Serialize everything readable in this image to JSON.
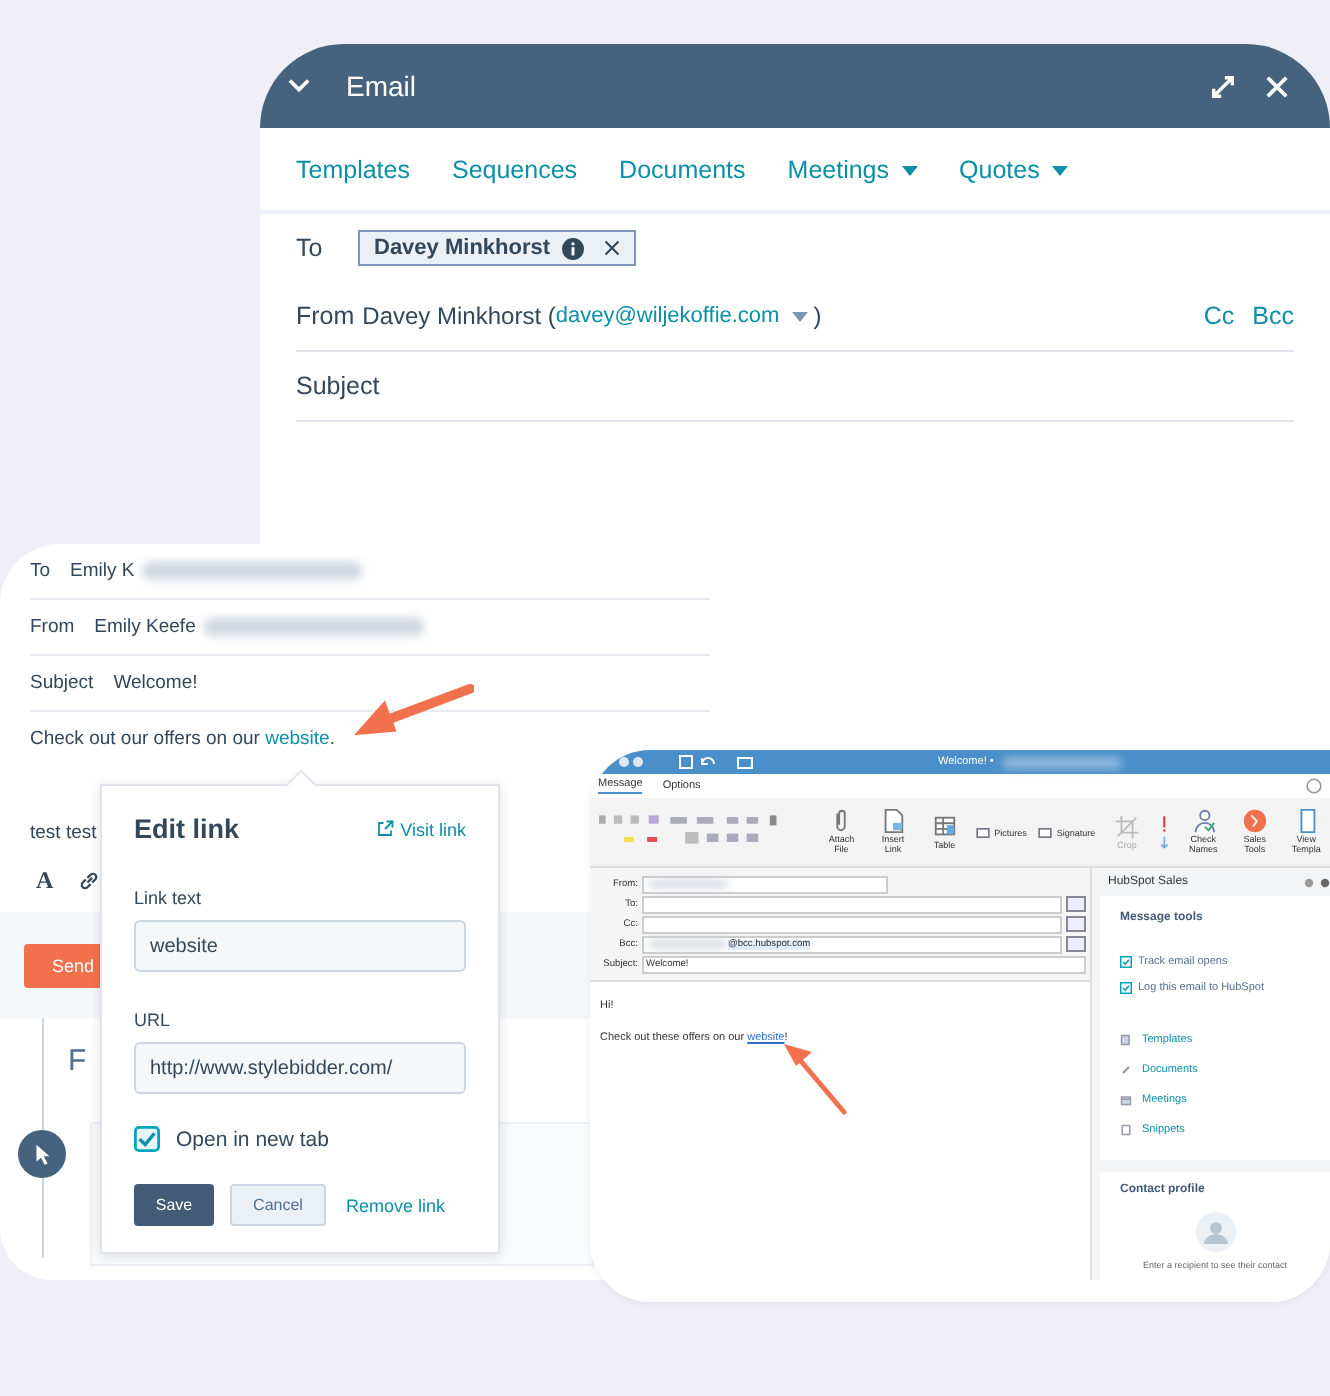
{
  "email_window": {
    "title": "Email",
    "tabs": [
      {
        "label": "Templates",
        "dropdown": false
      },
      {
        "label": "Sequences",
        "dropdown": false
      },
      {
        "label": "Documents",
        "dropdown": false
      },
      {
        "label": "Meetings",
        "dropdown": true
      },
      {
        "label": "Quotes",
        "dropdown": true
      }
    ],
    "to": {
      "label": "To",
      "recipient": "Davey Minkhorst"
    },
    "from": {
      "label": "From",
      "name": "Davey Minkhorst",
      "open": "(",
      "email": "davey@wiljekoffie.com",
      "close": ")"
    },
    "cc": "Cc",
    "bcc": "Bcc",
    "subject_label": "Subject"
  },
  "compose": {
    "rows": [
      {
        "label": "To",
        "value": "Emily K",
        "blurred": true
      },
      {
        "label": "From",
        "value": "Emily Keefe",
        "blurred": true
      },
      {
        "label": "Subject",
        "value": "Welcome!",
        "blurred": false
      }
    ],
    "body": {
      "before": "Check out our offers on our ",
      "link": "website",
      "after": "."
    },
    "second_line": "test test",
    "format_button": "A",
    "send": "Send",
    "heading_fragment": "F"
  },
  "edit_link": {
    "title": "Edit link",
    "visit": "Visit link",
    "link_text_label": "Link text",
    "link_text": "website",
    "url_label": "URL",
    "url": "http://www.stylebidder.com/",
    "open_in_new_tab": {
      "label": "Open in new tab",
      "checked": true
    },
    "save": "Save",
    "cancel": "Cancel",
    "remove": "Remove link"
  },
  "outlook": {
    "title": "Welcome! •",
    "tabs": [
      {
        "label": "Message",
        "selected": true
      },
      {
        "label": "Options",
        "selected": false
      }
    ],
    "ribbon": [
      {
        "label": "Attach File",
        "kind": "clip",
        "disabled": false
      },
      {
        "label": "Insert Link",
        "kind": "doc",
        "disabled": false
      },
      {
        "label": "Table",
        "kind": "table",
        "disabled": false
      },
      {
        "label": "Pictures",
        "kind": "small",
        "disabled": false
      },
      {
        "label": "Signature",
        "kind": "small",
        "disabled": false
      },
      {
        "label": "Crop",
        "kind": "crop",
        "disabled": true
      },
      {
        "label": "Check Names",
        "kind": "people",
        "disabled": false
      },
      {
        "label": "Sales Tools",
        "kind": "sales",
        "disabled": false
      },
      {
        "label": "View Templa",
        "kind": "template",
        "disabled": false
      }
    ],
    "fields": [
      {
        "label": "From:",
        "kind": "select",
        "blurred": true
      },
      {
        "label": "To:",
        "kind": "address",
        "blurred": false
      },
      {
        "label": "Cc:",
        "kind": "address",
        "blurred": false
      },
      {
        "label": "Bcc:",
        "kind": "address",
        "blurred": true,
        "value": "@bcc.hubspot.com"
      },
      {
        "label": "Subject:",
        "kind": "text",
        "blurred": false,
        "value": "Welcome!"
      }
    ],
    "greeting": "Hi!",
    "body": {
      "before": "Check out these offers on our ",
      "link": "website",
      "after": "!"
    },
    "panel": {
      "title": "HubSpot Sales",
      "tools_title": "Message tools",
      "options": [
        {
          "label": "Track email opens",
          "checked": true
        },
        {
          "label": "Log this email to HubSpot",
          "checked": true
        }
      ],
      "links": [
        {
          "label": "Templates",
          "kind": "templates"
        },
        {
          "label": "Documents",
          "kind": "documents"
        },
        {
          "label": "Meetings",
          "kind": "meetings"
        },
        {
          "label": "Snippets",
          "kind": "snippets"
        }
      ],
      "profile_title": "Contact profile",
      "profile_hint": "Enter a recipient to see their contact"
    }
  }
}
